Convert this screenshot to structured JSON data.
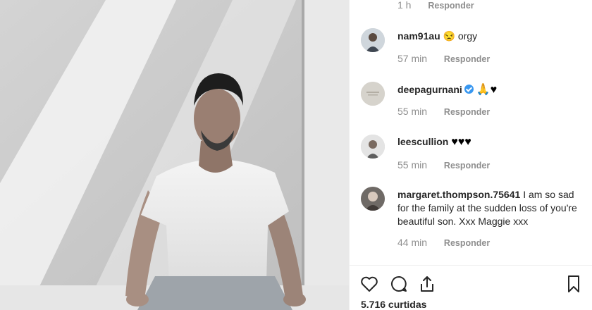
{
  "comments": [
    {
      "user": "",
      "text": "",
      "time": "1 h",
      "reply": "Responder"
    },
    {
      "user": "nam91au",
      "text": "😒 orgy",
      "time": "57 min",
      "reply": "Responder"
    },
    {
      "user": "deepagurnani",
      "text": "🙏♥",
      "time": "55 min",
      "reply": "Responder",
      "verified": true
    },
    {
      "user": "leescullion",
      "text": "♥♥♥",
      "time": "55 min",
      "reply": "Responder"
    },
    {
      "user": "margaret.thompson.75641",
      "text": "I am so sad for the family at the sudden loss of you're beautiful son. Xxx Maggie xxx",
      "time": "44 min",
      "reply": "Responder"
    }
  ],
  "actions": {
    "like_icon": "heart-outline-icon",
    "comment_icon": "comment-bubble-icon",
    "share_icon": "share-icon",
    "save_icon": "bookmark-icon",
    "likes_text": "5.716 curtidas"
  },
  "colors": {
    "verified": "#3897f0",
    "muted": "#8e8e8e",
    "text": "#262626"
  }
}
